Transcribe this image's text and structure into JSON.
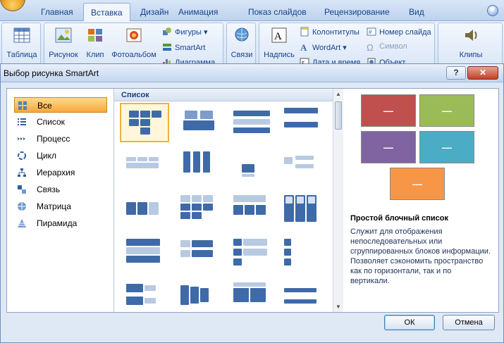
{
  "ribbon": {
    "tabs": [
      "Главная",
      "Вставка",
      "Дизайн",
      "Анимация",
      "Показ слайдов",
      "Рецензирование",
      "Вид"
    ],
    "active_tab": "Вставка",
    "help_label": "?",
    "buttons": {
      "table": "Таблица",
      "picture": "Рисунок",
      "clip": "Клип",
      "photo_album": "Фотоальбом",
      "shapes": "Фигуры",
      "smartart": "SmartArt",
      "chart": "Диаграмма",
      "links": "Связи",
      "textbox": "Надпись",
      "header_footer": "Колонтитулы",
      "wordart": "WordArt",
      "date_time": "Дата и время",
      "slide_number": "Номер слайда",
      "symbol": "Символ",
      "object": "Объект",
      "clips": "Клипы"
    }
  },
  "dialog": {
    "title": "Выбор рисунка SmartArt",
    "help_btn": "?",
    "close_btn": "✕",
    "categories": [
      {
        "label": "Все",
        "icon": "all-icon"
      },
      {
        "label": "Список",
        "icon": "list-icon"
      },
      {
        "label": "Процесс",
        "icon": "process-icon"
      },
      {
        "label": "Цикл",
        "icon": "cycle-icon"
      },
      {
        "label": "Иерархия",
        "icon": "hierarchy-icon"
      },
      {
        "label": "Связь",
        "icon": "relationship-icon"
      },
      {
        "label": "Матрица",
        "icon": "matrix-icon"
      },
      {
        "label": "Пирамида",
        "icon": "pyramid-icon"
      }
    ],
    "selected_category": "Все",
    "layout_header": "Список",
    "preview": {
      "placeholder": "—",
      "colors": [
        "#c0504d",
        "#9bbb59",
        "#8064a2",
        "#4bacc6",
        "#f79646"
      ],
      "title": "Простой блочный список",
      "description": "Служит для отображения непоследовательных или сгруппированных блоков информации. Позволяет сэкономить пространство как по горизонтали, так и по вертикали."
    },
    "ok_label": "ОК",
    "cancel_label": "Отмена"
  }
}
